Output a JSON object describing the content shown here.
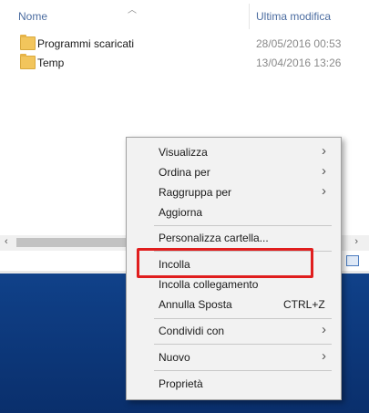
{
  "columns": {
    "name": "Nome",
    "date": "Ultima modifica"
  },
  "files": [
    {
      "name": "Programmi scaricati",
      "date": "28/05/2016 00:53",
      "icon": "folder-icon"
    },
    {
      "name": "Temp",
      "date": "13/04/2016 13:26",
      "icon": "folder-icon"
    }
  ],
  "scrollbar": {
    "left_arrow": "‹",
    "right_arrow": "›"
  },
  "context_menu": {
    "items": {
      "visualizza": "Visualizza",
      "ordina_per": "Ordina per",
      "raggruppa_per": "Raggruppa per",
      "aggiorna": "Aggiorna",
      "personalizza": "Personalizza cartella...",
      "incolla": "Incolla",
      "incolla_collegamento": "Incolla collegamento",
      "annulla_sposta": "Annulla Sposta",
      "annulla_sposta_shortcut": "CTRL+Z",
      "condividi_con": "Condividi con",
      "nuovo": "Nuovo",
      "proprieta": "Proprietà"
    },
    "submenu_arrow": "›"
  },
  "colors": {
    "highlight": "#e01e1e",
    "header_text": "#4b6ca0",
    "folder": "#f2c55c"
  }
}
